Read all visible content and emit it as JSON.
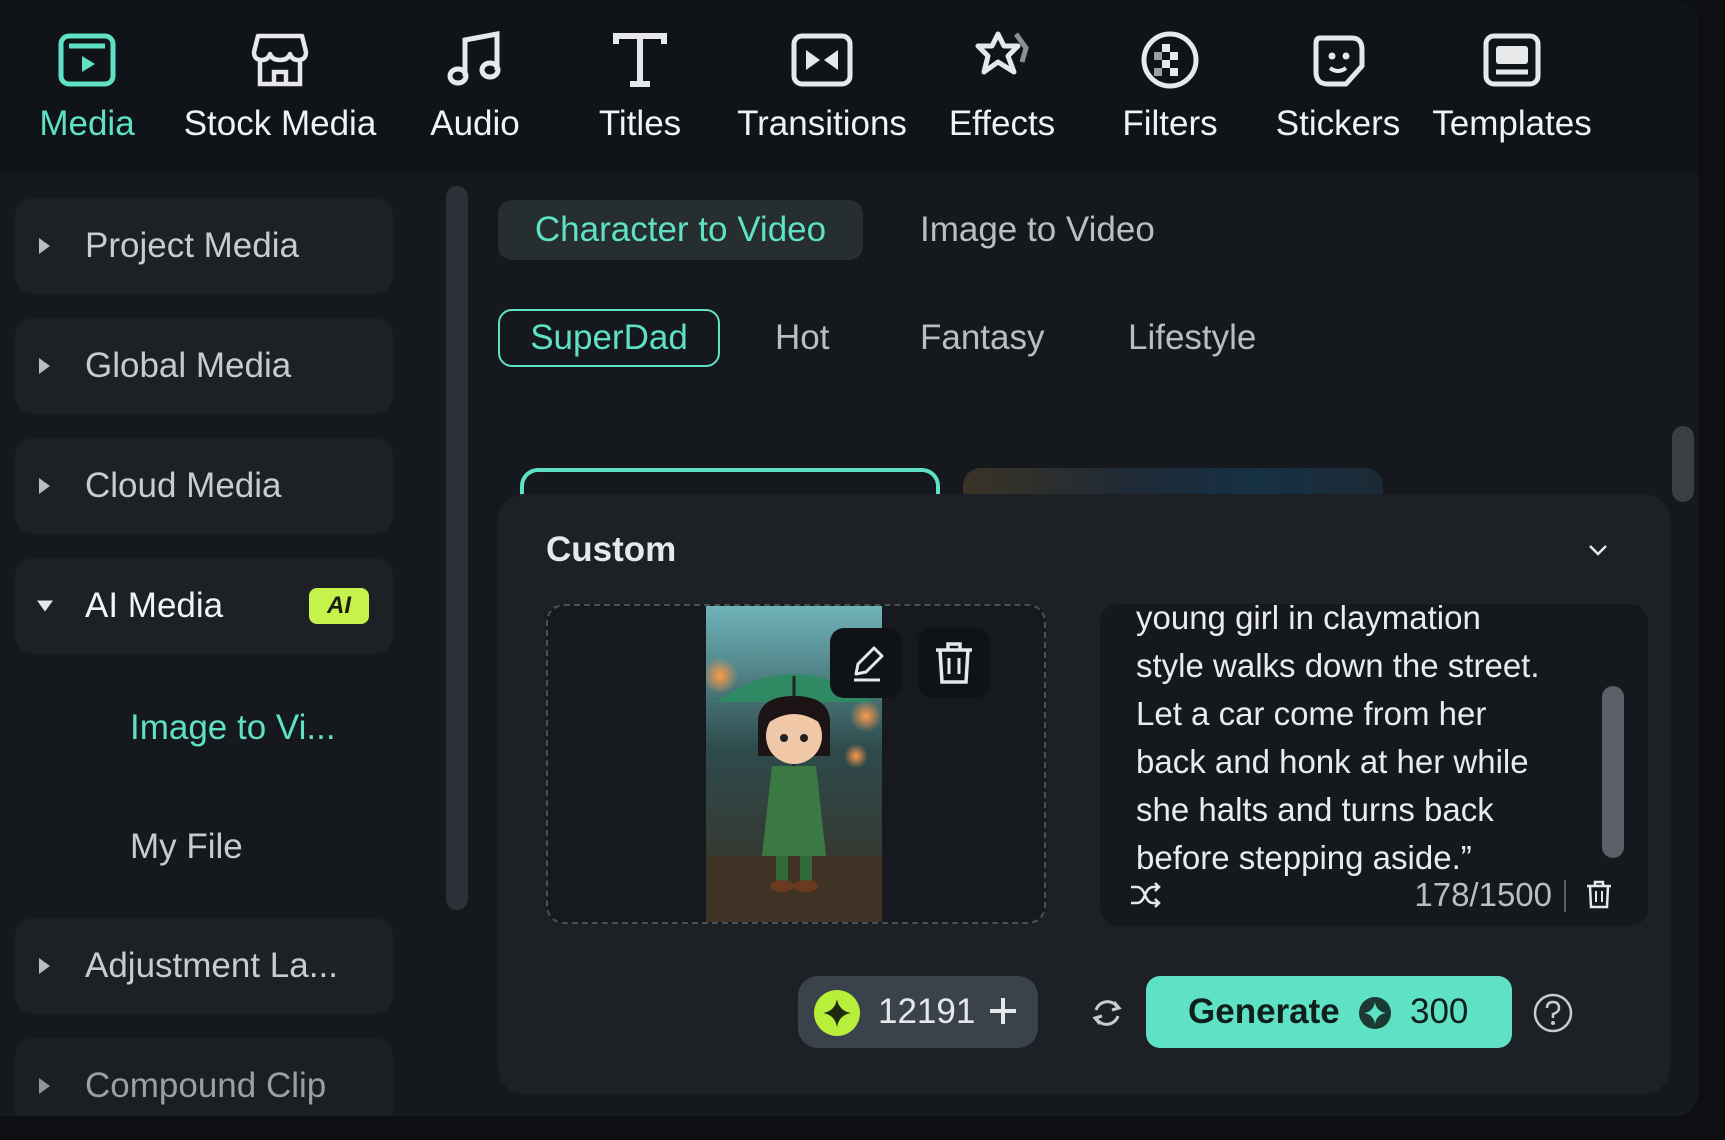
{
  "toolbar": {
    "items": [
      {
        "label": "Media",
        "icon": "media-icon",
        "active": true
      },
      {
        "label": "Stock Media",
        "icon": "stock-media-icon"
      },
      {
        "label": "Audio",
        "icon": "music-note-icon"
      },
      {
        "label": "Titles",
        "icon": "text-t-icon"
      },
      {
        "label": "Transitions",
        "icon": "transition-icon"
      },
      {
        "label": "Effects",
        "icon": "effects-star-icon"
      },
      {
        "label": "Filters",
        "icon": "filter-icon"
      },
      {
        "label": "Stickers",
        "icon": "sticker-icon"
      },
      {
        "label": "Templates",
        "icon": "template-icon"
      }
    ]
  },
  "sidebar": {
    "items": [
      {
        "label": "Project Media"
      },
      {
        "label": "Global Media"
      },
      {
        "label": "Cloud Media"
      },
      {
        "label": "AI Media",
        "badge": "AI",
        "expanded": true
      },
      {
        "label": "Adjustment La..."
      },
      {
        "label": "Compound Clip"
      }
    ],
    "sub_items": [
      {
        "label": "Image to Vi...",
        "active": true
      },
      {
        "label": "My File"
      }
    ]
  },
  "main": {
    "mode_tabs": [
      {
        "label": "Character to Video",
        "active": true
      },
      {
        "label": "Image to Video"
      }
    ],
    "categories": [
      {
        "label": "SuperDad",
        "active": true
      },
      {
        "label": "Hot"
      },
      {
        "label": "Fantasy"
      },
      {
        "label": "Lifestyle"
      }
    ]
  },
  "custom_panel": {
    "title": "Custom",
    "prompt_lines": [
      "young girl in claymation",
      "style walks down the street.",
      "Let a car come from her",
      "back and honk at her while",
      "she halts and turns back",
      "before stepping aside.”"
    ],
    "char_count": "178/1500",
    "credits": "12191",
    "generate_label": "Generate",
    "generate_cost": "300"
  },
  "colors": {
    "accent": "#5ee1c4",
    "badge": "#c6f24c",
    "coin": "#b7f03a"
  }
}
